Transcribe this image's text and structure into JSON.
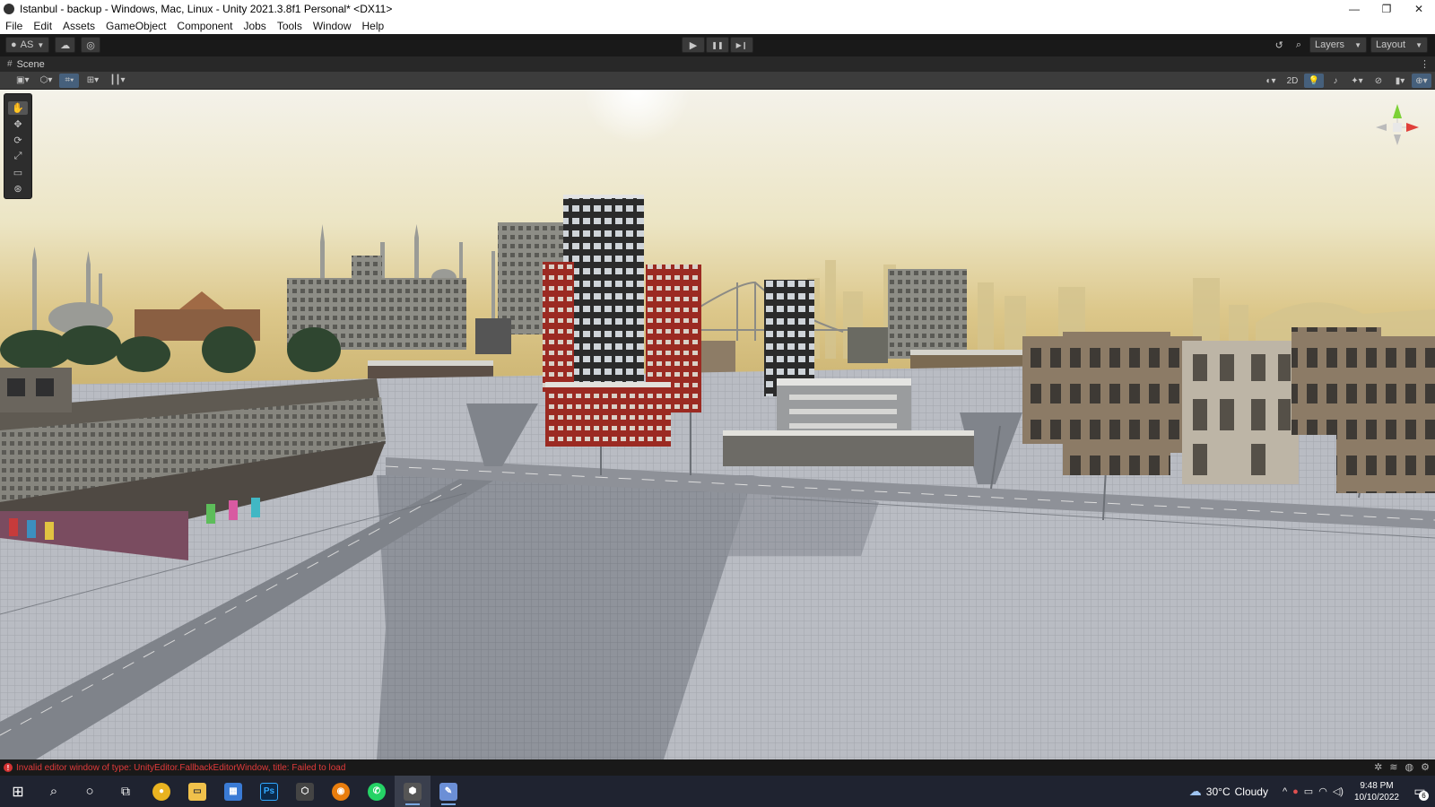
{
  "window": {
    "title": "Istanbul - backup - Windows, Mac, Linux - Unity 2021.3.8f1 Personal* <DX11>",
    "controls": {
      "minimize": "—",
      "restore": "❐",
      "close": "✕"
    }
  },
  "menu": [
    "File",
    "Edit",
    "Assets",
    "GameObject",
    "Component",
    "Jobs",
    "Tools",
    "Window",
    "Help"
  ],
  "toolbar": {
    "account_label": "AS",
    "play_icon": "▶",
    "pause_icon": "❚❚",
    "step_icon": "▶❙",
    "layers_label": "Layers",
    "layout_label": "Layout"
  },
  "scene": {
    "tab_label": "Scene",
    "toggle_2d": "2D"
  },
  "tools": [
    "hand-tool",
    "move-tool",
    "rotate-tool",
    "scale-tool",
    "rect-tool",
    "transform-tool"
  ],
  "status": {
    "error_message": "Invalid editor window of type: UnityEditor.FallbackEditorWindow, title: Failed to load"
  },
  "taskbar": {
    "apps": [
      {
        "name": "chrome",
        "glyph": "●",
        "color": "#e9b320"
      },
      {
        "name": "file-explorer",
        "glyph": "▭",
        "color": "#f0c14b"
      },
      {
        "name": "store",
        "glyph": "▦",
        "color": "#3a7bd5"
      },
      {
        "name": "photoshop",
        "glyph": "Ps",
        "color": "#0b2a4a"
      },
      {
        "name": "unity-hub",
        "glyph": "⬡",
        "color": "#444"
      },
      {
        "name": "blender",
        "glyph": "◉",
        "color": "#e87d0d"
      },
      {
        "name": "whatsapp",
        "glyph": "✆",
        "color": "#25d366"
      },
      {
        "name": "unity",
        "glyph": "⬢",
        "color": "#555"
      },
      {
        "name": "paint",
        "glyph": "✎",
        "color": "#6b8fd6"
      }
    ],
    "weather_temp": "30°C",
    "weather_desc": "Cloudy",
    "time": "9:48 PM",
    "date": "10/10/2022",
    "notification_count": "6"
  }
}
